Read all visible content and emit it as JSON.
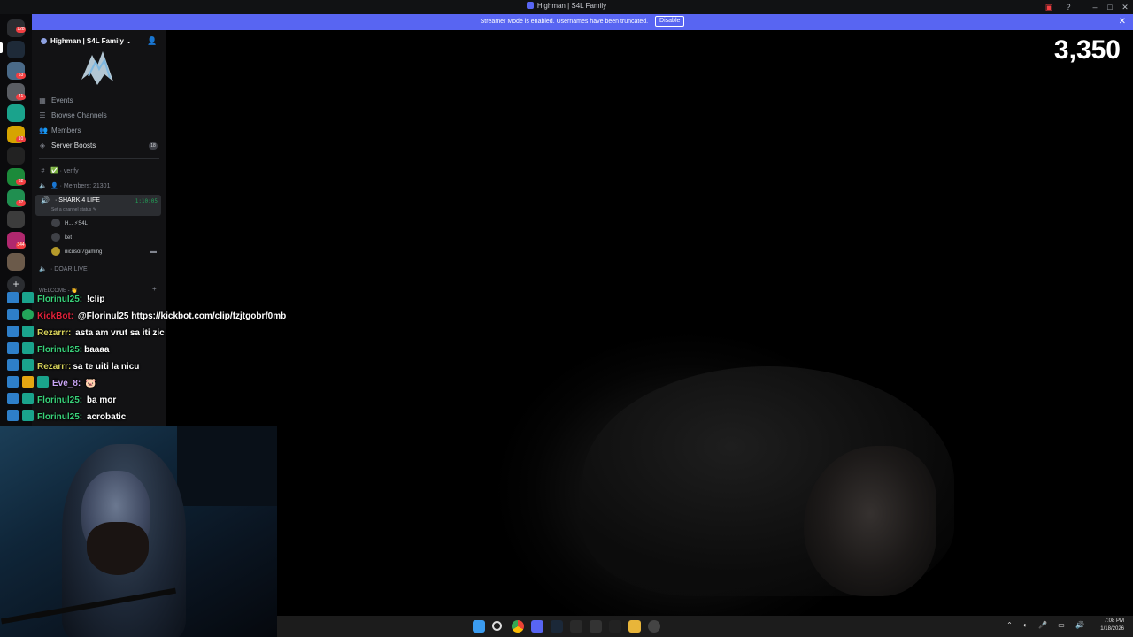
{
  "window": {
    "title": "Highman | S4L Family"
  },
  "banner": {
    "text": "Streamer Mode is enabled. Usernames have been truncated.",
    "disable_label": "Disable",
    "close_icon": "close-icon"
  },
  "rail": {
    "badges": [
      "128",
      "63",
      "41",
      "10",
      "62",
      "97",
      "344"
    ],
    "add_icon": "+"
  },
  "server": {
    "name": "Highman | S4L Family ⌄",
    "nav": [
      {
        "icon": "calendar-icon",
        "label": "Events"
      },
      {
        "icon": "browse-icon",
        "label": "Browse Channels"
      },
      {
        "icon": "members-icon",
        "label": "Members"
      },
      {
        "icon": "boost-icon",
        "label": "Server Boosts",
        "badge": "18"
      }
    ],
    "channels": {
      "verify": "✅ · verify",
      "members": "👤 · Members: 21301",
      "voice_active": {
        "name": "· SHARK 4 LIFE",
        "status": "Set a channel status ✎",
        "timer": "1:10:05",
        "users": [
          "H... ⚡S4L",
          "ket",
          "nicusor7gaming"
        ]
      },
      "doar_live": "· DOAR LIVE",
      "welcome_category": "WELCOME - 👋"
    }
  },
  "viewer_count": "3,350",
  "chat": [
    {
      "user": "Florinul25:",
      "color": "#39d27a",
      "message": "!clip"
    },
    {
      "user": "KickBot:",
      "color": "#e0213a",
      "message": "@Florinul25 https://kickbot.com/clip/fzjtgobrf0mb"
    },
    {
      "user": "Rezarrr:",
      "color": "#d8d35a",
      "message": "asta am vrut sa iti zic"
    },
    {
      "user": "Florinul25:",
      "color": "#39d27a",
      "message": "baaaa"
    },
    {
      "user": "Rezarrr:",
      "color": "#d8d35a",
      "message": "sa te uiti la nicu"
    },
    {
      "user": "Eve_8:",
      "color": "#c9a5f5",
      "message": "🐷"
    },
    {
      "user": "Florinul25:",
      "color": "#39d27a",
      "message": "ba mor"
    },
    {
      "user": "Florinul25:",
      "color": "#39d27a",
      "message": "acrobatic"
    }
  ],
  "taskbar": {
    "time": "7:08 PM",
    "date": "1/18/2026"
  }
}
